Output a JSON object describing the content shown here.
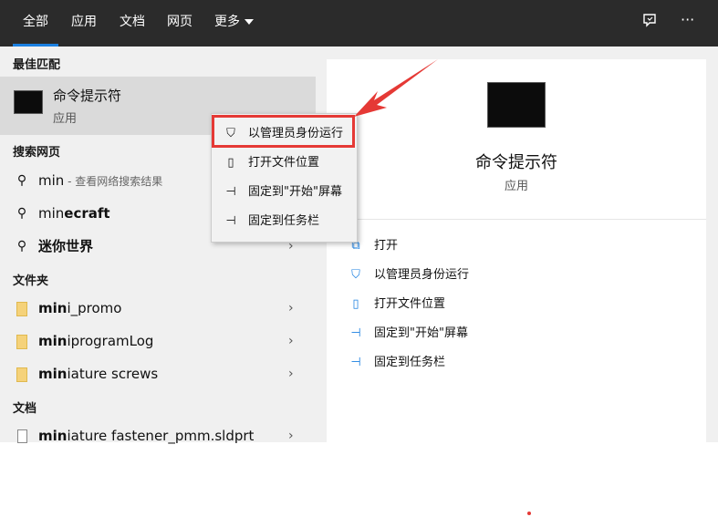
{
  "tabs": [
    {
      "label": "全部"
    },
    {
      "label": "应用"
    },
    {
      "label": "文档"
    },
    {
      "label": "网页"
    },
    {
      "label": "更多"
    }
  ],
  "header_icons": {
    "feedback": "feedback-icon",
    "more": "···"
  },
  "best_match": {
    "section": "最佳匹配",
    "title": "命令提示符",
    "subtitle": "应用"
  },
  "web": {
    "section": "搜索网页",
    "items": [
      {
        "bold": "",
        "normal": "min",
        "sub": " - 查看网络搜索结果"
      },
      {
        "normal": "min",
        "bold": "ecraft"
      },
      {
        "bold": "迷你世界"
      }
    ]
  },
  "folders": {
    "section": "文件夹",
    "items": [
      {
        "bold": "min",
        "normal": "i_promo"
      },
      {
        "bold": "min",
        "normal": "iprogramLog"
      },
      {
        "bold": "min",
        "normal": "iature screws"
      }
    ]
  },
  "documents": {
    "section": "文档",
    "items": [
      {
        "bold": "min",
        "normal": "iature fastener_pmm.sldprt"
      }
    ]
  },
  "context_menu": {
    "items": [
      {
        "label": "以管理员身份运行",
        "icon": "shield-icon"
      },
      {
        "label": "打开文件位置",
        "icon": "file-location-icon"
      },
      {
        "label": "固定到\"开始\"屏幕",
        "icon": "pin-icon"
      },
      {
        "label": "固定到任务栏",
        "icon": "pin-icon"
      }
    ]
  },
  "preview": {
    "title": "命令提示符",
    "subtitle": "应用",
    "actions": [
      {
        "label": "打开",
        "icon": "open-icon"
      },
      {
        "label": "以管理员身份运行",
        "icon": "shield-icon"
      },
      {
        "label": "打开文件位置",
        "icon": "file-location-icon"
      },
      {
        "label": "固定到\"开始\"屏幕",
        "icon": "pin-icon"
      },
      {
        "label": "固定到任务栏",
        "icon": "pin-icon"
      }
    ]
  },
  "colors": {
    "accent": "#1a7fe0",
    "highlight": "#e53935",
    "topbar": "#2b2b2b"
  }
}
